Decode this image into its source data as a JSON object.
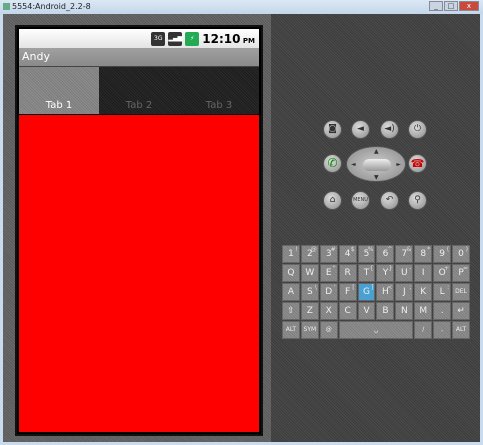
{
  "window": {
    "title": "5554:Android_2.2-8",
    "controls": [
      "_",
      "□",
      "x"
    ]
  },
  "status_bar": {
    "network": "3G",
    "time": "12:10",
    "ampm": "PM"
  },
  "app": {
    "title": "Andy",
    "tabs": [
      {
        "label": "Tab 1",
        "active": true
      },
      {
        "label": "Tab 2",
        "active": false
      },
      {
        "label": "Tab 3",
        "active": false
      }
    ],
    "content_color": "#ff0000"
  },
  "hardware_buttons": [
    {
      "name": "camera",
      "glyph": "◙"
    },
    {
      "name": "volume-down",
      "glyph": "◄"
    },
    {
      "name": "volume-up",
      "glyph": "◄)"
    },
    {
      "name": "power",
      "glyph": "⏻"
    },
    {
      "name": "call",
      "glyph": "✆"
    },
    {
      "name": "end-call",
      "glyph": "☎"
    },
    {
      "name": "home",
      "glyph": "⌂"
    },
    {
      "name": "menu",
      "glyph": "MENU"
    },
    {
      "name": "back",
      "glyph": "↶"
    },
    {
      "name": "search",
      "glyph": "⚲"
    }
  ],
  "keyboard": {
    "rows": [
      [
        {
          "k": "1",
          "a": "!"
        },
        {
          "k": "2",
          "a": "@"
        },
        {
          "k": "3",
          "a": "#"
        },
        {
          "k": "4",
          "a": "$"
        },
        {
          "k": "5",
          "a": "%"
        },
        {
          "k": "6",
          "a": "^"
        },
        {
          "k": "7",
          "a": "&"
        },
        {
          "k": "8",
          "a": "*"
        },
        {
          "k": "9",
          "a": "("
        },
        {
          "k": "0",
          "a": ")"
        }
      ],
      [
        {
          "k": "Q",
          "a": ""
        },
        {
          "k": "W",
          "a": ""
        },
        {
          "k": "E",
          "a": "\""
        },
        {
          "k": "R",
          "a": ""
        },
        {
          "k": "T",
          "a": "{"
        },
        {
          "k": "Y",
          "a": "}"
        },
        {
          "k": "U",
          "a": "-"
        },
        {
          "k": "I",
          "a": ""
        },
        {
          "k": "O",
          "a": "+"
        },
        {
          "k": "P",
          "a": "="
        }
      ],
      [
        {
          "k": "A",
          "a": ""
        },
        {
          "k": "S",
          "a": "\\"
        },
        {
          "k": "D",
          "a": "'"
        },
        {
          "k": "F",
          "a": "["
        },
        {
          "k": "G",
          "a": "]"
        },
        {
          "k": "H",
          "a": "<"
        },
        {
          "k": "J",
          "a": ";"
        },
        {
          "k": "K",
          "a": ""
        },
        {
          "k": "L",
          "a": ":"
        },
        {
          "k": "DEL",
          "a": ""
        }
      ],
      [
        {
          "k": "⇧",
          "a": ""
        },
        {
          "k": "Z",
          "a": ""
        },
        {
          "k": "X",
          "a": ""
        },
        {
          "k": "C",
          "a": ""
        },
        {
          "k": "V",
          "a": ""
        },
        {
          "k": "B",
          "a": ""
        },
        {
          "k": "N",
          "a": ""
        },
        {
          "k": "M",
          "a": ""
        },
        {
          "k": ".",
          "a": ""
        },
        {
          "k": "↵",
          "a": ""
        }
      ]
    ],
    "bottom": {
      "alt_left": "ALT",
      "sym": "SYM",
      "at": "@",
      "space": "␣",
      "slash": "/",
      "comma": ",",
      "alt_right": "ALT"
    },
    "highlighted_key": "G"
  }
}
